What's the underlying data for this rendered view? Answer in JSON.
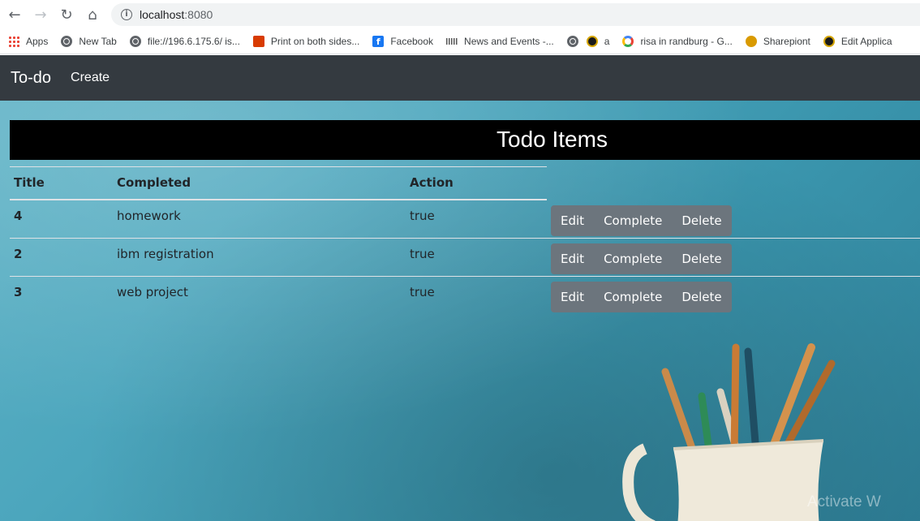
{
  "browser": {
    "url_host": "localhost",
    "url_port": ":8080",
    "bookmarks": [
      {
        "label": "Apps",
        "icon": "apps-icon"
      },
      {
        "label": "New Tab",
        "icon": "globe-icon"
      },
      {
        "label": "file://196.6.175.6/ is...",
        "icon": "globe-icon"
      },
      {
        "label": "Print on both sides...",
        "icon": "office-icon"
      },
      {
        "label": "Facebook",
        "icon": "facebook-icon"
      },
      {
        "label": "News and Events -...",
        "icon": "cisco-icon"
      },
      {
        "label": "",
        "icon": "globe-icon"
      },
      {
        "label": "a",
        "icon": "seal-icon"
      },
      {
        "label": "risa in randburg - G...",
        "icon": "google-icon"
      },
      {
        "label": "Sharepiont",
        "icon": "sharepoint-icon"
      },
      {
        "label": "Edit Applica",
        "icon": "seal-icon"
      }
    ]
  },
  "navbar": {
    "brand": "To-do",
    "create": "Create"
  },
  "page": {
    "heading": "Todo Items"
  },
  "table": {
    "headers": [
      "Title",
      "Completed",
      "Action"
    ],
    "rows": [
      {
        "id": "4",
        "title": "homework",
        "completed": "true"
      },
      {
        "id": "2",
        "title": "ibm registration",
        "completed": "true"
      },
      {
        "id": "3",
        "title": "web project",
        "completed": "true"
      }
    ],
    "actions": {
      "edit": "Edit",
      "complete": "Complete",
      "delete": "Delete"
    }
  },
  "watermark": "Activate W",
  "colors": {
    "navbar": "#343a40",
    "button": "#6c757d",
    "title_bar": "#000000"
  }
}
